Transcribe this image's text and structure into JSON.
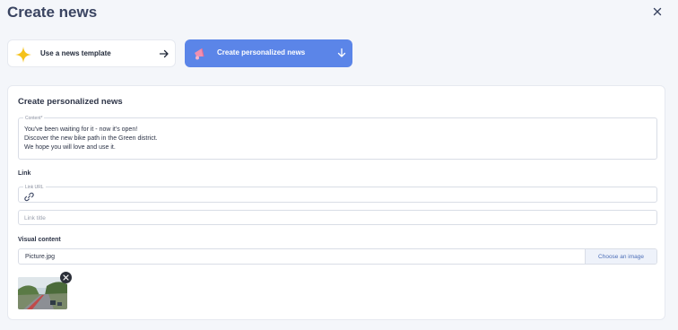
{
  "header": {
    "title": "Create news",
    "close_icon": "close-icon"
  },
  "options": {
    "template": {
      "label": "Use a news template",
      "icon": "sparkle-icon",
      "arrow": "arrow-right-icon"
    },
    "personalized": {
      "label": "Create personalized news",
      "icon": "megaphone-icon",
      "arrow": "arrow-down-icon"
    }
  },
  "colors": {
    "accent": "#5b85e8",
    "sparkle": "#f5c21b",
    "megaphone": "#f08fb0"
  },
  "form": {
    "title": "Create personalized news",
    "content": {
      "legend": "Content*",
      "lines": [
        "You've been waiting for it - now it's open!",
        "Discover the new bike path in the Green district.",
        "We hope you will love and use it."
      ]
    },
    "link": {
      "section_label": "Link",
      "url_legend": "Link URL",
      "url_icon": "link-icon",
      "title_placeholder": "Link title"
    },
    "visual": {
      "section_label": "Visual content",
      "file_name": "Picture.jpg",
      "choose_label": "Choose an image",
      "remove_icon": "close-circle-icon"
    }
  }
}
